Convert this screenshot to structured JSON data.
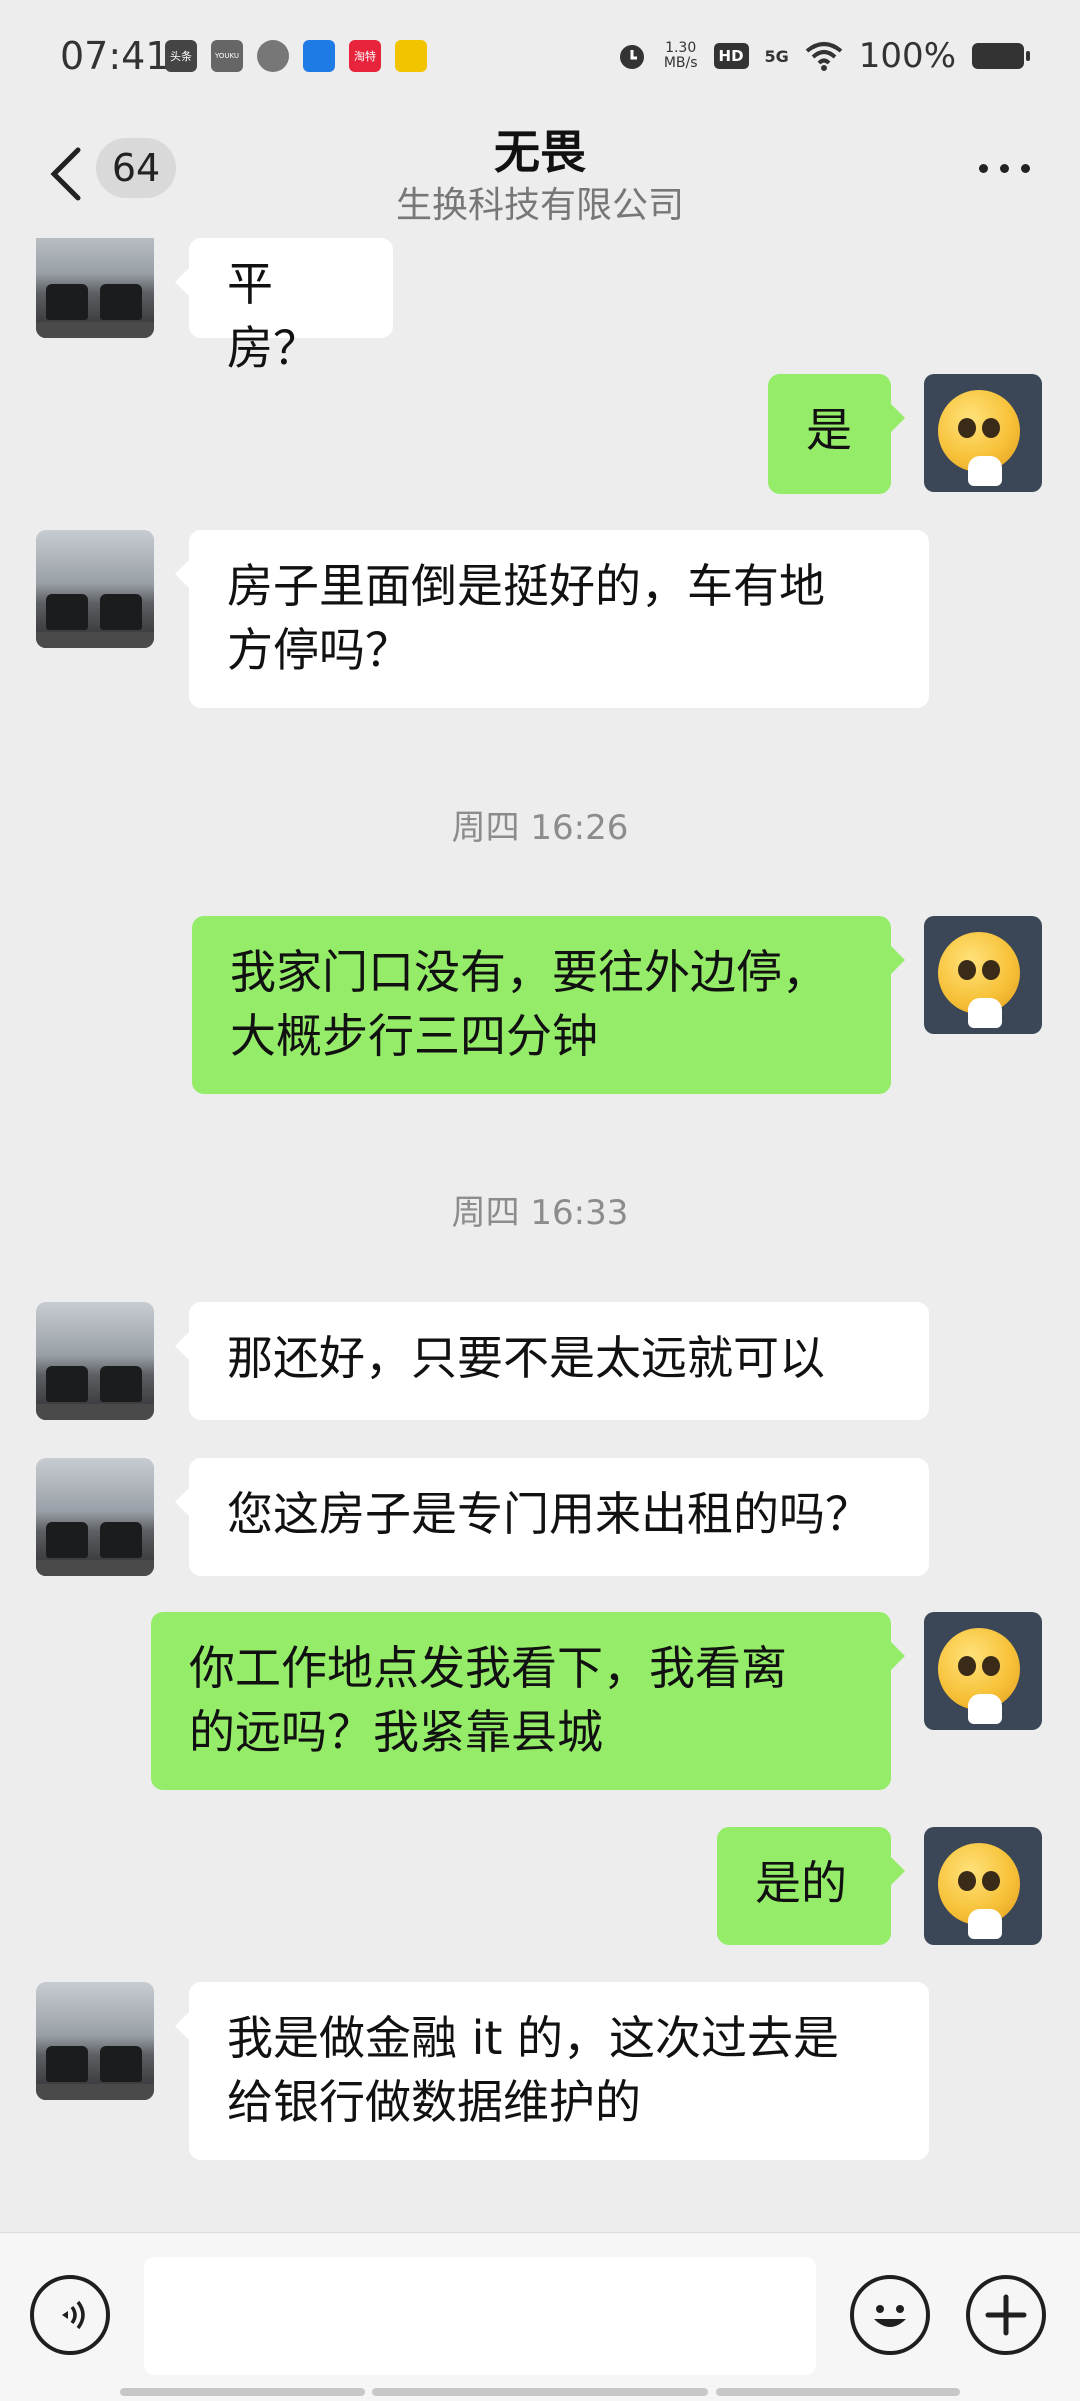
{
  "status_bar": {
    "time": "07:41",
    "apps": [
      "头条",
      "YOUKU",
      "",
      "",
      "淘特",
      ""
    ],
    "net_speed": "1.30\nMB/s",
    "hd": "HD",
    "signal": "5G",
    "battery": "100%"
  },
  "header": {
    "unread_count": "64",
    "title": "无畏",
    "subtitle": "生换科技有限公司"
  },
  "messages": [
    {
      "side": "in",
      "text": "平房？"
    },
    {
      "side": "out",
      "text": "是"
    },
    {
      "side": "in",
      "text": "房子里面倒是挺好的，车有地\n方停吗？"
    },
    {
      "type": "time",
      "text": "周四 16:26"
    },
    {
      "side": "out",
      "text": "我家门口没有，要往外边停，\n大概步行三四分钟"
    },
    {
      "type": "time",
      "text": "周四 16:33"
    },
    {
      "side": "in",
      "text": "那还好，只要不是太远就可以"
    },
    {
      "side": "in",
      "text": "您这房子是专门用来出租的吗？"
    },
    {
      "side": "out",
      "text": "你工作地点发我看下，我看离\n的远吗？我紧靠县城"
    },
    {
      "side": "out",
      "text": "是的"
    },
    {
      "side": "in",
      "text": "我是做金融 it 的，这次过去是\n给银行做数据维护的"
    }
  ],
  "input": {
    "value": ""
  },
  "icons": {
    "back": "chevron-left-icon",
    "more": "more-horizontal-icon",
    "voice": "voice-icon",
    "emoji": "emoji-icon",
    "plus": "plus-icon"
  }
}
